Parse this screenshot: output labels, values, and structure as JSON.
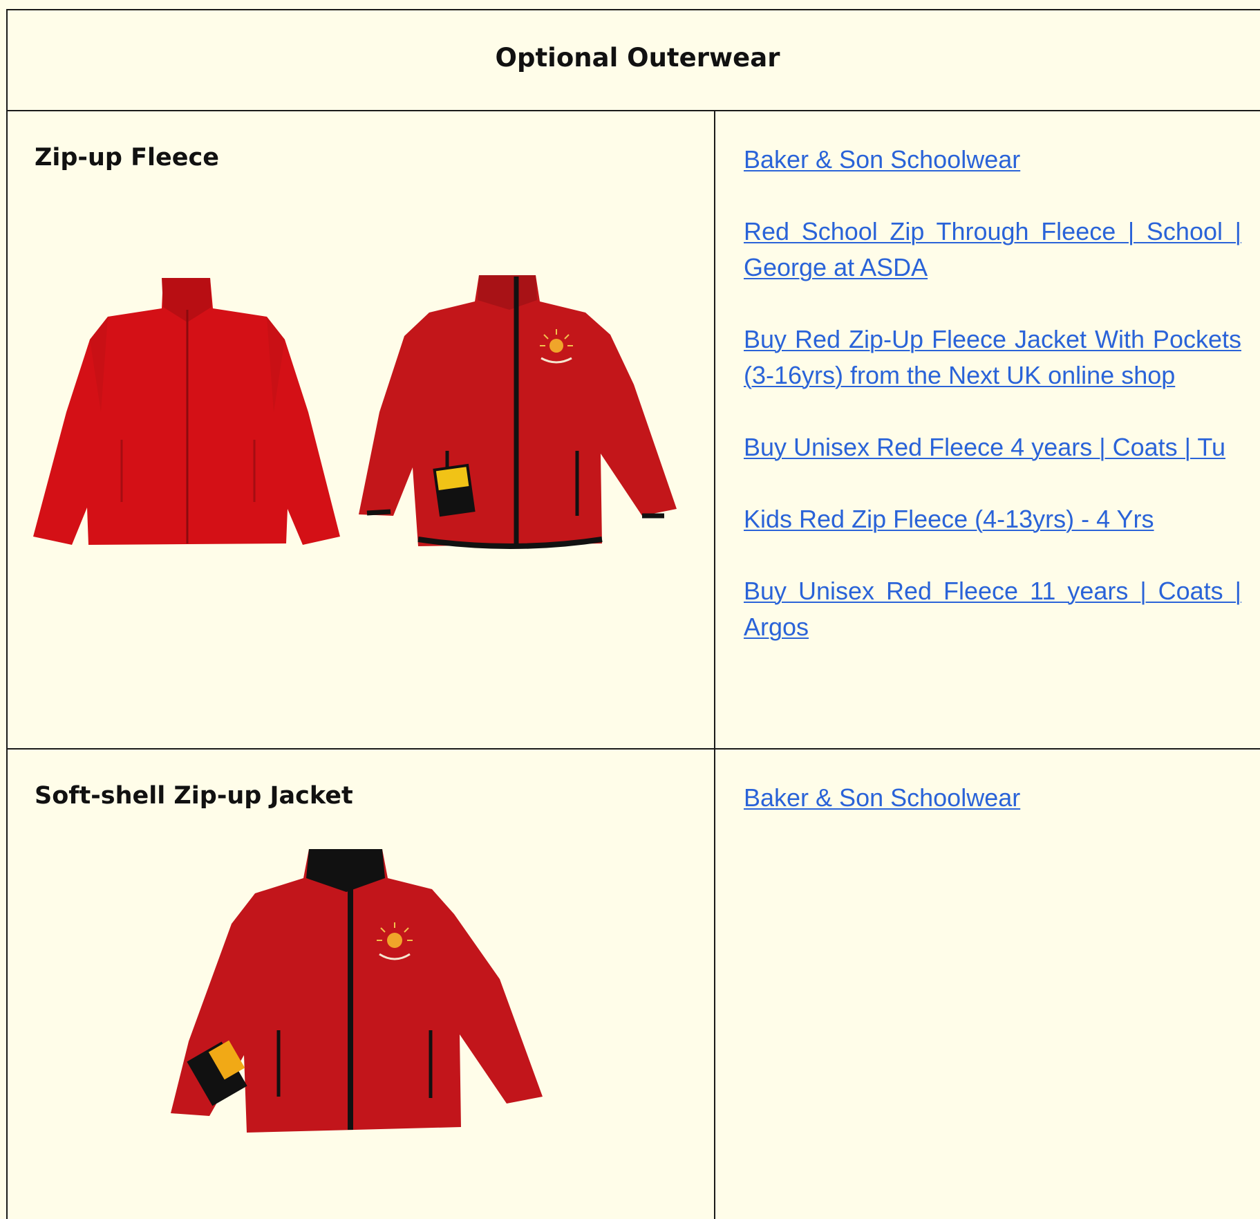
{
  "table": {
    "title": "Optional Outerwear"
  },
  "rows": [
    {
      "item": "Zip-up Fleece",
      "images": [
        {
          "alt": "plain-red-fleece-photo",
          "color": "#d41016"
        },
        {
          "alt": "red-school-fleece-photo",
          "color": "#c3161a"
        }
      ],
      "links": [
        "Baker & Son Schoolwear",
        "Red School Zip Through Fleece | School | George at ASDA",
        "Buy Red Zip-Up Fleece Jacket With Pockets (3-16yrs) from the Next UK online shop",
        "Buy Unisex Red Fleece 4 years | Coats | Tu",
        "Kids Red Zip Fleece (4-13yrs) - 4 Yrs",
        "Buy Unisex Red Fleece 11 years | Coats | Argos"
      ]
    },
    {
      "item": "Soft-shell Zip-up Jacket",
      "images": [
        {
          "alt": "red-softshell-jacket-photo",
          "color": "#c2151b"
        }
      ],
      "links": [
        "Baker & Son Schoolwear"
      ]
    }
  ],
  "colors": {
    "background": "#fffde9",
    "border": "#1a1a1a",
    "link": "#2a63d8",
    "garment_red": "#c9151a"
  }
}
